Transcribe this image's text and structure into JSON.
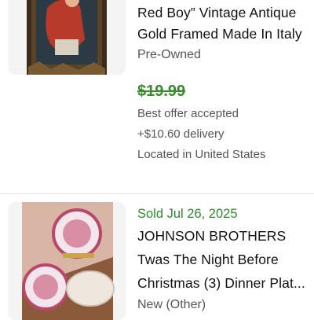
{
  "listings": [
    {
      "title_lines": [
        "Red Boy” Vintage Antique",
        "Gold Framed Made In Italy"
      ],
      "condition": "Pre-Owned",
      "price": "$19.99",
      "offer": "Best offer accepted",
      "delivery": "+$10.60 delivery",
      "location": "Located in United States",
      "image_icon": "framed-portrait-image"
    },
    {
      "sold": "Sold Jul 26, 2025",
      "title_lines": [
        "JOHNSON BROTHERS",
        "Twas The Night Before",
        "Christmas (3) Dinner Plat..."
      ],
      "condition": "New (Other)",
      "image_icon": "christmas-plates-image"
    }
  ],
  "colors": {
    "price_green": "#3a8a2e",
    "sold_green": "#2f8a2a",
    "muted_text": "#555555",
    "image_bg": "#f4f4f4"
  }
}
